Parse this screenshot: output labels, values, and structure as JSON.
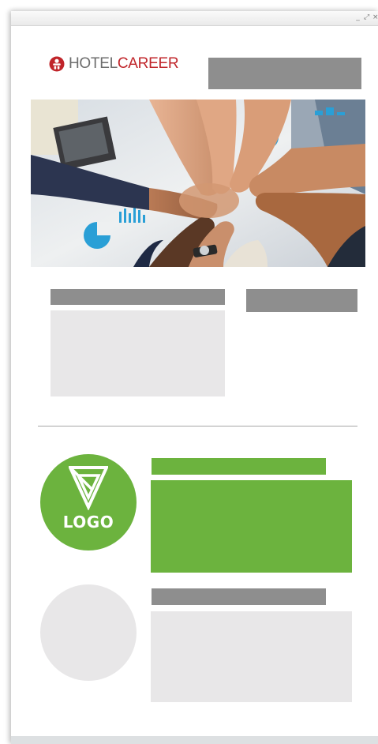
{
  "window": {
    "controls": {
      "minimize": "_",
      "restore": "⤢",
      "close": "×"
    }
  },
  "brand": {
    "hotel": "HOTEL",
    "career": "CAREER",
    "icon": "hotelcareer-logo-icon",
    "colors": {
      "hotel": "#6d6d6d",
      "career": "#c0252a"
    }
  },
  "hero": {
    "image": "team-hands-stacked-photo"
  },
  "company_logo": {
    "text": "LOGO",
    "icon": "triangle-logo-icon",
    "color": "#6cb33e"
  },
  "colors": {
    "placeholder_dark": "#8e8e8e",
    "placeholder_light": "#e8e7e8",
    "accent_green": "#6cb33e"
  }
}
